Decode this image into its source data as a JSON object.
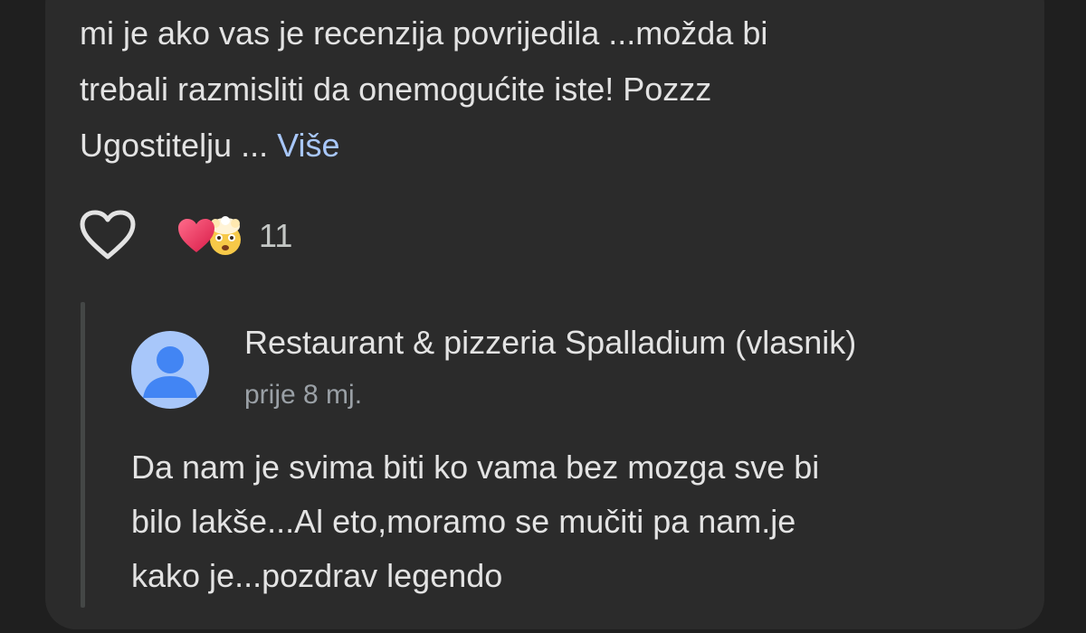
{
  "review": {
    "text_lines": [
      "mi je ako vas je recenzija povrijedila ...možda bi",
      "trebali razmisliti da onemogućite iste! Pozzz",
      "Ugostitelju ..."
    ],
    "more_label": "Više"
  },
  "reactions": {
    "count": "11",
    "emojis": [
      "heart-emoji",
      "exploding-head-emoji"
    ]
  },
  "owner_reply": {
    "name": "Restaurant & pizzeria Spalladium (vlasnik)",
    "date": "prije 8 mj.",
    "text_lines": [
      "Da nam je svima biti ko vama bez mozga sve bi",
      "bilo lakše...Al eto,moramo se mučiti pa nam.je",
      "kako je...pozdrav legendo"
    ]
  },
  "colors": {
    "background": "#1f1f1f",
    "card": "#2b2b2b",
    "text_primary": "#e3e3e3",
    "text_secondary": "#9aa0a6",
    "link": "#a8c7fa",
    "avatar_bg": "#a8c7fa",
    "avatar_fg": "#4285f4"
  }
}
